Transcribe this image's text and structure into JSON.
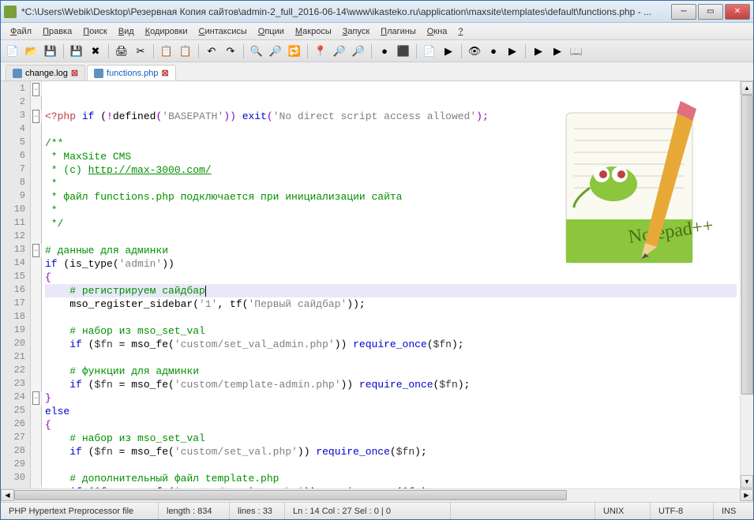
{
  "title": "*C:\\Users\\Webik\\Desktop\\Резервная Копия сайтов\\admin-2_full_2016-06-14\\www\\ikasteko.ru\\application\\maxsite\\templates\\default\\functions.php - ...",
  "menus": [
    "Файл",
    "Правка",
    "Поиск",
    "Вид",
    "Кодировки",
    "Синтаксисы",
    "Опции",
    "Макросы",
    "Запуск",
    "Плагины",
    "Окна",
    "?"
  ],
  "tabs": [
    {
      "label": "change.log",
      "active": false
    },
    {
      "label": "functions.php",
      "active": true
    }
  ],
  "code": {
    "lines": [
      {
        "n": 1,
        "fold": "box-minus",
        "segs": [
          {
            "t": "<?php ",
            "c": "red"
          },
          {
            "t": "if",
            "c": "kw"
          },
          {
            "t": " ("
          },
          {
            "t": "!",
            "c": "op"
          },
          {
            "t": "defined"
          },
          {
            "t": "(",
            "c": "op"
          },
          {
            "t": "'BASEPATH'",
            "c": "str"
          },
          {
            "t": ")) ",
            "c": "op"
          },
          {
            "t": "exit",
            "c": "kw"
          },
          {
            "t": "(",
            "c": "op"
          },
          {
            "t": "'No direct script access allowed'",
            "c": "str"
          },
          {
            "t": ");",
            "c": "op"
          }
        ]
      },
      {
        "n": 2,
        "fold": "line",
        "segs": []
      },
      {
        "n": 3,
        "fold": "box-minus",
        "segs": [
          {
            "t": "/**",
            "c": "com"
          }
        ]
      },
      {
        "n": 4,
        "fold": "line",
        "segs": [
          {
            "t": " * MaxSite CMS",
            "c": "com"
          }
        ]
      },
      {
        "n": 5,
        "fold": "line",
        "segs": [
          {
            "t": " * (c) ",
            "c": "com"
          },
          {
            "t": "http://max-3000.com/",
            "c": "lnk"
          }
        ]
      },
      {
        "n": 6,
        "fold": "line",
        "segs": [
          {
            "t": " *",
            "c": "com"
          }
        ]
      },
      {
        "n": 7,
        "fold": "line",
        "segs": [
          {
            "t": " * файл functions.php подключается при инициализации сайта",
            "c": "com"
          }
        ]
      },
      {
        "n": 8,
        "fold": "line",
        "segs": [
          {
            "t": " *",
            "c": "com"
          }
        ]
      },
      {
        "n": 9,
        "fold": "line",
        "segs": [
          {
            "t": " */",
            "c": "com"
          }
        ]
      },
      {
        "n": 10,
        "fold": "line",
        "segs": []
      },
      {
        "n": 11,
        "fold": "line",
        "segs": [
          {
            "t": "# данные для админки",
            "c": "com"
          }
        ]
      },
      {
        "n": 12,
        "fold": "line",
        "segs": [
          {
            "t": "if",
            "c": "kw"
          },
          {
            "t": " (is_type("
          },
          {
            "t": "'admin'",
            "c": "str"
          },
          {
            "t": "))"
          }
        ]
      },
      {
        "n": 13,
        "fold": "box-minus",
        "segs": [
          {
            "t": "{",
            "c": "op"
          }
        ]
      },
      {
        "n": 14,
        "fold": "line",
        "hl": true,
        "segs": [
          {
            "t": "    "
          },
          {
            "t": "# регистрируем сайдбар",
            "c": "com"
          },
          {
            "t": "",
            "caret": true
          }
        ]
      },
      {
        "n": 15,
        "fold": "line",
        "segs": [
          {
            "t": "    mso_register_sidebar("
          },
          {
            "t": "'1'",
            "c": "str"
          },
          {
            "t": ", tf("
          },
          {
            "t": "'Первый сайдбар'",
            "c": "str"
          },
          {
            "t": "));"
          }
        ]
      },
      {
        "n": 16,
        "fold": "line",
        "segs": []
      },
      {
        "n": 17,
        "fold": "line",
        "segs": [
          {
            "t": "    "
          },
          {
            "t": "# набор из mso_set_val",
            "c": "com"
          }
        ]
      },
      {
        "n": 18,
        "fold": "line",
        "segs": [
          {
            "t": "    "
          },
          {
            "t": "if",
            "c": "kw"
          },
          {
            "t": " ("
          },
          {
            "t": "$fn",
            "c": "var"
          },
          {
            "t": " = mso_fe("
          },
          {
            "t": "'custom/set_val_admin.php'",
            "c": "str"
          },
          {
            "t": ")) "
          },
          {
            "t": "require_once",
            "c": "kw"
          },
          {
            "t": "("
          },
          {
            "t": "$fn",
            "c": "var"
          },
          {
            "t": ");"
          }
        ]
      },
      {
        "n": 19,
        "fold": "line",
        "segs": []
      },
      {
        "n": 20,
        "fold": "line",
        "segs": [
          {
            "t": "    "
          },
          {
            "t": "# функции для админки",
            "c": "com"
          }
        ]
      },
      {
        "n": 21,
        "fold": "line",
        "segs": [
          {
            "t": "    "
          },
          {
            "t": "if",
            "c": "kw"
          },
          {
            "t": " ("
          },
          {
            "t": "$fn",
            "c": "var"
          },
          {
            "t": " = mso_fe("
          },
          {
            "t": "'custom/template-admin.php'",
            "c": "str"
          },
          {
            "t": ")) "
          },
          {
            "t": "require_once",
            "c": "kw"
          },
          {
            "t": "("
          },
          {
            "t": "$fn",
            "c": "var"
          },
          {
            "t": ");"
          }
        ]
      },
      {
        "n": 22,
        "fold": "line",
        "segs": [
          {
            "t": "}",
            "c": "op"
          }
        ]
      },
      {
        "n": 23,
        "fold": "line",
        "segs": [
          {
            "t": "else",
            "c": "kw"
          }
        ]
      },
      {
        "n": 24,
        "fold": "box-minus",
        "segs": [
          {
            "t": "{",
            "c": "op"
          }
        ]
      },
      {
        "n": 25,
        "fold": "line",
        "segs": [
          {
            "t": "    "
          },
          {
            "t": "# набор из mso_set_val",
            "c": "com"
          }
        ]
      },
      {
        "n": 26,
        "fold": "line",
        "segs": [
          {
            "t": "    "
          },
          {
            "t": "if",
            "c": "kw"
          },
          {
            "t": " ("
          },
          {
            "t": "$fn",
            "c": "var"
          },
          {
            "t": " = mso_fe("
          },
          {
            "t": "'custom/set_val.php'",
            "c": "str"
          },
          {
            "t": ")) "
          },
          {
            "t": "require_once",
            "c": "kw"
          },
          {
            "t": "("
          },
          {
            "t": "$fn",
            "c": "var"
          },
          {
            "t": ");"
          }
        ]
      },
      {
        "n": 27,
        "fold": "line",
        "segs": []
      },
      {
        "n": 28,
        "fold": "line",
        "segs": [
          {
            "t": "    "
          },
          {
            "t": "# дополнительный файл template.php",
            "c": "com"
          }
        ]
      },
      {
        "n": 29,
        "fold": "line",
        "segs": [
          {
            "t": "    "
          },
          {
            "t": "if",
            "c": "kw"
          },
          {
            "t": " ("
          },
          {
            "t": "$fn",
            "c": "var"
          },
          {
            "t": " = mso_fe("
          },
          {
            "t": "'custom/template.php'",
            "c": "str"
          },
          {
            "t": ")) "
          },
          {
            "t": "require_once",
            "c": "kw"
          },
          {
            "t": "("
          },
          {
            "t": "$fn",
            "c": "var"
          },
          {
            "t": ");"
          }
        ]
      },
      {
        "n": 30,
        "fold": "line",
        "segs": [
          {
            "t": "}",
            "c": "op"
          }
        ]
      }
    ]
  },
  "status": {
    "filetype": "PHP Hypertext Preprocessor file",
    "length": "length : 834",
    "lines": "lines : 33",
    "pos": "Ln : 14   Col : 27   Sel : 0 | 0",
    "eol": "UNIX",
    "enc": "UTF-8",
    "ins": "INS"
  },
  "toolbar_icons": [
    "📄",
    "📂",
    "💾",
    "💾",
    "✖",
    "🖨",
    "✂",
    "📋",
    "📋",
    "↶",
    "↷",
    "🔍",
    "🔎",
    "🔁",
    "📍",
    "🔎",
    "🔎",
    "●",
    "⬛",
    "📄",
    "▶",
    "👁",
    "●",
    "▶",
    "▶",
    "▶",
    "📖"
  ]
}
